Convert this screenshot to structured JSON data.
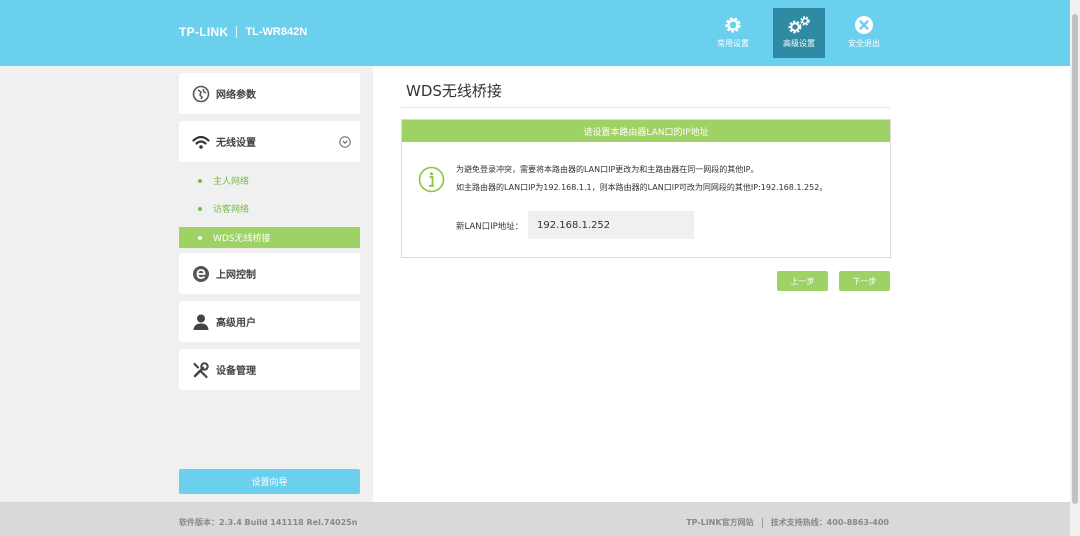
{
  "brand": {
    "logo": "TP-LINK",
    "model": "TL-WR842N"
  },
  "nav": [
    {
      "label": "常用设置",
      "icon": "gear-icon"
    },
    {
      "label": "高级设置",
      "icon": "gears-icon"
    },
    {
      "label": "安全退出",
      "icon": "close-circle-icon"
    }
  ],
  "sidebar": {
    "items": [
      {
        "label": "网络参数",
        "icon": "network-globe-icon"
      },
      {
        "label": "无线设置",
        "icon": "wifi-icon",
        "expanded": true
      },
      {
        "label": "上网控制",
        "icon": "internet-e-icon"
      },
      {
        "label": "高级用户",
        "icon": "user-icon"
      },
      {
        "label": "设备管理",
        "icon": "tools-icon"
      }
    ],
    "wireless_sub": [
      {
        "label": "主人网络"
      },
      {
        "label": "访客网络"
      },
      {
        "label": "WDS无线桥接",
        "active": true
      }
    ],
    "wizard_label": "设置向导"
  },
  "main": {
    "title": "WDS无线桥接",
    "panel_title": "请设置本路由器LAN口的IP地址",
    "info_line1": "为避免登录冲突，需要将本路由器的LAN口IP更改为和主路由器在同一网段的其他IP。",
    "info_line2": "如主路由器的LAN口IP为192.168.1.1，则本路由器的LAN口IP可改为同网段的其他IP:192.168.1.252。",
    "ip_label": "新LAN口IP地址：",
    "ip_value": "192.168.1.252",
    "prev_label": "上一步",
    "next_label": "下一步"
  },
  "footer": {
    "version": "软件版本：2.3.4 Build 141118 Rel.74025n",
    "site": "TP-LINK官方网站",
    "hotline": "技术支持热线：400-8863-400"
  },
  "colors": {
    "header": "#6bcfee",
    "accent_green": "#9ed264",
    "active_nav": "#2f8aa4"
  }
}
